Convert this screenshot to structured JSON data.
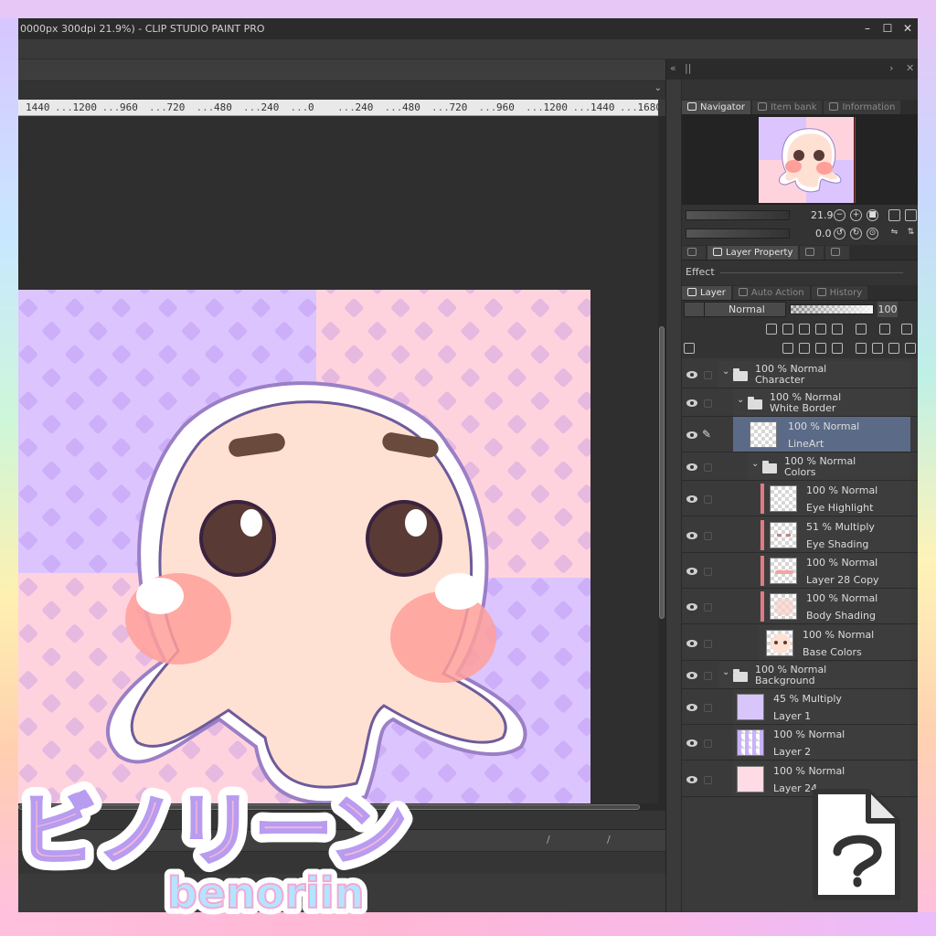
{
  "window": {
    "title": "0000px 300dpi 21.9%) - CLIP STUDIO PAINT PRO",
    "controls": [
      "–",
      "☐",
      "✕"
    ]
  },
  "ruler": {
    "ticks": [
      "1440",
      "1200",
      "960",
      "720",
      "480",
      "240",
      "0",
      "240",
      "480",
      "720",
      "960",
      "1200",
      "1440",
      "1680"
    ]
  },
  "dock": {
    "top_left": "«",
    "top_right": [
      "›",
      "✕"
    ],
    "panel1_tabs": [
      "Navigator",
      "Item bank",
      "Information"
    ],
    "panel2_tabs": [
      "Layer Property"
    ],
    "panel3_tabs": [
      "Layer",
      "Auto Action",
      "History"
    ]
  },
  "navigator": {
    "zoom": "21.9",
    "rotation": "0.0"
  },
  "effect": {
    "label": "Effect"
  },
  "layer_toolbar": {
    "blend_mode": "Normal",
    "opacity": "100"
  },
  "layers": [
    {
      "line1": "100 % Normal",
      "line2": "Character"
    },
    {
      "line1": "100 % Normal",
      "line2": "White Border"
    },
    {
      "line1": "100 % Normal",
      "line2": "LineArt"
    },
    {
      "line1": "100 % Normal",
      "line2": "Colors"
    },
    {
      "line1": "100 % Normal",
      "line2": "Eye Highlight"
    },
    {
      "line1": "51 % Multiply",
      "line2": "Eye Shading"
    },
    {
      "line1": "100 % Normal",
      "line2": "Layer 28 Copy"
    },
    {
      "line1": "100 % Normal",
      "line2": "Body Shading"
    },
    {
      "line1": "100 % Normal",
      "line2": "Base Colors"
    },
    {
      "line1": "100 % Normal",
      "line2": "Background"
    },
    {
      "line1": "45 % Multiply",
      "line2": "Layer 1"
    },
    {
      "line1": "100 % Normal",
      "line2": "Layer 2"
    },
    {
      "line1": "100 % Normal",
      "line2": "Layer 24"
    }
  ],
  "watermark": {
    "japanese": "ビノリーン",
    "latin": "benoriin"
  },
  "colors": {
    "selected_layer": "#5b6a86",
    "clip_marker": "#e07a84",
    "canvas_pink": "#ffd2de",
    "canvas_purple": "#d9c2ff"
  },
  "icons": [
    "eye-icon",
    "lock-icon",
    "folder-icon",
    "pen-icon",
    "navigator-icon",
    "layer-icon",
    "clip-studio-file-icon"
  ]
}
